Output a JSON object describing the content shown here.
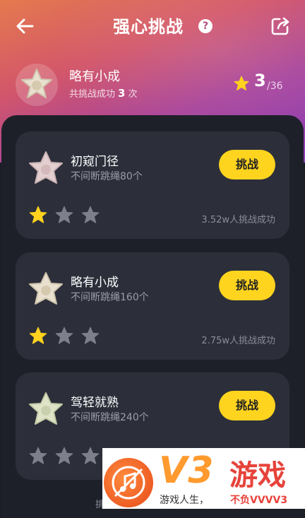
{
  "header": {
    "title": "强心挑战",
    "help_icon": "?"
  },
  "current": {
    "level_name": "略有小成",
    "success_prefix": "共挑战成功",
    "success_count": "3",
    "success_suffix": "次",
    "stars_earned": "3",
    "stars_total": "/36"
  },
  "challenges": [
    {
      "name": "初窥门径",
      "desc": "不间断跳绳80个",
      "button": "挑战",
      "stars_filled": 1,
      "stars_total": 3,
      "count": "3.52w人挑战成功"
    },
    {
      "name": "略有小成",
      "desc": "不间断跳绳160个",
      "button": "挑战",
      "stars_filled": 1,
      "stars_total": 3,
      "count": "2.75w人挑战成功"
    },
    {
      "name": "驾轻就熟",
      "desc": "不间断跳绳240个",
      "button": "挑战",
      "stars_filled": 0,
      "stars_total": 3,
      "count": ""
    }
  ],
  "watermark": {
    "logo": "V3",
    "brand": "游戏",
    "tagline": "游戏人生，",
    "tagline2": "不负VVVV3",
    "fragment": "挑"
  },
  "colors": {
    "accent_yellow": "#ffd41f",
    "star_filled": "#ffd21f",
    "star_empty": "#7d808a"
  }
}
